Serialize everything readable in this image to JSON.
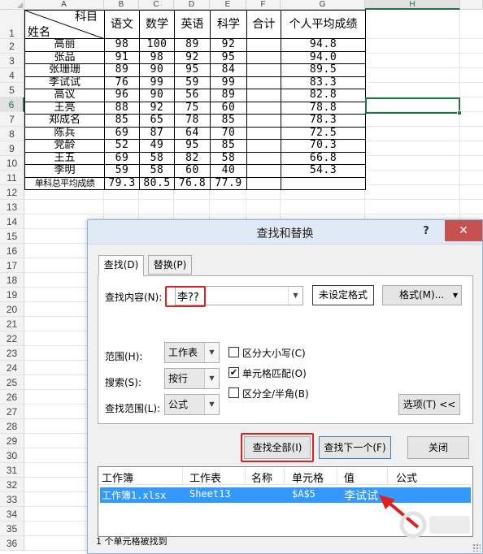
{
  "spreadsheet": {
    "columns": [
      "A",
      "B",
      "C",
      "D",
      "E",
      "F",
      "G",
      "H"
    ],
    "active_column": "H",
    "rows": [
      "1",
      "2",
      "3",
      "4",
      "5",
      "6",
      "7",
      "8",
      "9",
      "10",
      "11",
      "12",
      "13",
      "14",
      "15",
      "16",
      "17",
      "18",
      "19",
      "20",
      "21",
      "22",
      "23",
      "24",
      "25",
      "26",
      "27",
      "28",
      "29",
      "30",
      "31",
      "32",
      "33",
      "34",
      "35",
      "36"
    ],
    "active_row": "6",
    "diag_header": {
      "top": "科目",
      "bottom": "姓名"
    },
    "headers": [
      "语文",
      "数学",
      "英语",
      "科学",
      "合计",
      "个人平均成绩"
    ],
    "data_rows": [
      {
        "name": "高丽",
        "scores": [
          "98",
          "100",
          "89",
          "92"
        ],
        "total": "",
        "avg": "94.8"
      },
      {
        "name": "张品",
        "scores": [
          "91",
          "98",
          "92",
          "95"
        ],
        "total": "",
        "avg": "94.0"
      },
      {
        "name": "张珊珊",
        "scores": [
          "89",
          "90",
          "95",
          "84"
        ],
        "total": "",
        "avg": "89.5"
      },
      {
        "name": "李试试",
        "scores": [
          "76",
          "99",
          "59",
          "99"
        ],
        "total": "",
        "avg": "83.3"
      },
      {
        "name": "高议",
        "scores": [
          "96",
          "90",
          "56",
          "89"
        ],
        "total": "",
        "avg": "82.8"
      },
      {
        "name": "王亮",
        "scores": [
          "88",
          "92",
          "75",
          "60"
        ],
        "total": "",
        "avg": "78.8"
      },
      {
        "name": "郑成名",
        "scores": [
          "85",
          "65",
          "78",
          "85"
        ],
        "total": "",
        "avg": "78.3"
      },
      {
        "name": "陈兵",
        "scores": [
          "69",
          "87",
          "64",
          "70"
        ],
        "total": "",
        "avg": "72.5"
      },
      {
        "name": "党龄",
        "scores": [
          "52",
          "49",
          "95",
          "85"
        ],
        "total": "",
        "avg": "70.3"
      },
      {
        "name": "王五",
        "scores": [
          "69",
          "58",
          "82",
          "58"
        ],
        "total": "",
        "avg": "66.8"
      },
      {
        "name": "李明",
        "scores": [
          "59",
          "58",
          "60",
          "40"
        ],
        "total": "",
        "avg": "54.3"
      }
    ],
    "summary_row": {
      "label": "单科总平均成绩",
      "values": [
        "79.3",
        "80.5",
        "76.8",
        "77.9"
      ],
      "total": "",
      "avg": ""
    }
  },
  "dialog": {
    "title": "查找和替换",
    "help": "?",
    "close": "✕",
    "tabs": {
      "find": "查找(D)",
      "replace": "替换(P)"
    },
    "find_label": "查找内容(N):",
    "find_value": "李??",
    "format_status": "未设定格式",
    "format_button": "格式(M)...",
    "scope_label": "范围(H):",
    "scope_value": "工作表",
    "search_label": "搜索(S):",
    "search_value": "按行",
    "lookin_label": "查找范围(L):",
    "lookin_value": "公式",
    "match_case": {
      "label": "区分大小写(C)",
      "checked": false
    },
    "match_cell": {
      "label": "单元格匹配(O)",
      "checked": true
    },
    "match_width": {
      "label": "区分全/半角(B)",
      "checked": false
    },
    "options_button": "选项(T) <<",
    "find_all": "查找全部(I)",
    "find_next": "查找下一个(F)",
    "close_button": "关闭",
    "results_headers": [
      "工作簿",
      "工作表",
      "名称",
      "单元格",
      "值",
      "公式"
    ],
    "result": {
      "workbook": "工作簿1.xlsx",
      "sheet": "Sheet13",
      "name": "",
      "cell": "$A$5",
      "value": "李试试",
      "formula": ""
    },
    "status": "1 个单元格被找到"
  },
  "colors": {
    "selection_green": "#217346",
    "highlight_red": "#e02020",
    "result_blue": "#3399ff",
    "close_red": "#c75050"
  }
}
